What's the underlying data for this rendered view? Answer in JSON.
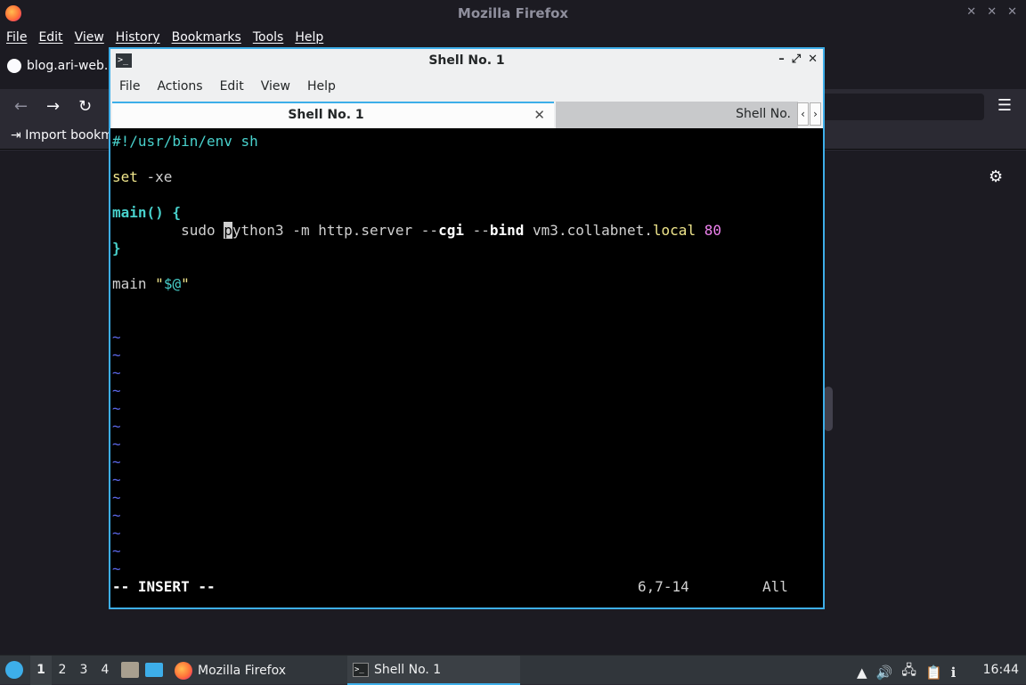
{
  "firefox": {
    "title": "Mozilla Firefox",
    "menu": [
      "File",
      "Edit",
      "View",
      "History",
      "Bookmarks",
      "Tools",
      "Help"
    ],
    "tab_title": "blog.ari-web.x",
    "bookmark_item": "Import bookm"
  },
  "terminal": {
    "title": "Shell No. 1",
    "menu": [
      "File",
      "Actions",
      "Edit",
      "View",
      "Help"
    ],
    "tabs": [
      {
        "label": "Shell No. 1",
        "active": true
      },
      {
        "label": "Shell No.",
        "active": false
      }
    ],
    "editor": {
      "shebang": "#!/usr/bin/env sh",
      "set_kw": "set",
      "set_args": " -xe",
      "func_decl": "main() {",
      "cmd_indent": "        sudo ",
      "cmd_cursor_char": "p",
      "cmd_rest_a": "ython3 -m http.server --",
      "cmd_cgi": "cgi",
      "cmd_mid": " --",
      "cmd_bind": "bind",
      "cmd_host_a": " vm3.collabnet.",
      "cmd_local": "local",
      "cmd_space": " ",
      "cmd_port": "80",
      "close_brace": "}",
      "call_name": "main ",
      "call_quote_open": "\"",
      "call_var": "$@",
      "call_quote_close": "\"",
      "tilde": "~",
      "mode": "-- INSERT --",
      "position": "6,7-14",
      "scroll": "All"
    }
  },
  "taskbar": {
    "desktops": [
      "1",
      "2",
      "3",
      "4"
    ],
    "active_desktop": "1",
    "tasks": [
      "Mozilla Firefox",
      "Shell No. 1"
    ],
    "clock": "16:44"
  }
}
